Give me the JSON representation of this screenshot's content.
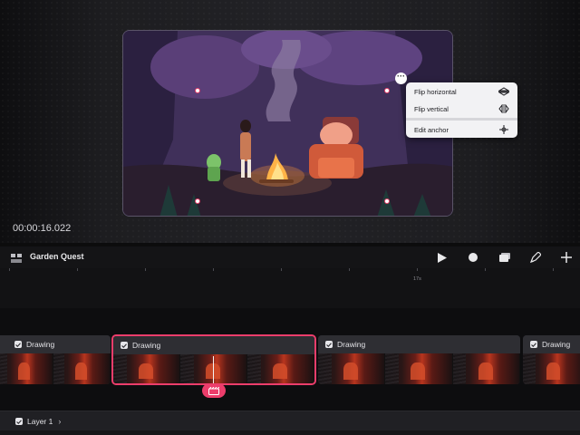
{
  "canvas": {
    "timecode": "00:00:16.022"
  },
  "context_menu": {
    "items": [
      {
        "label": "Flip horizontal",
        "icon": "flip-horizontal-icon"
      },
      {
        "label": "Flip vertical",
        "icon": "flip-vertical-icon"
      },
      {
        "label": "Edit anchor",
        "icon": "move-anchor-icon"
      }
    ]
  },
  "toolbar": {
    "project_title": "Garden Quest",
    "icons": [
      "layout-icon",
      "play-icon",
      "record-icon",
      "layers-icon",
      "draw-icon",
      "add-icon"
    ]
  },
  "ruler": {
    "label": "17s"
  },
  "tracks": {
    "clips": [
      {
        "label": "Drawing",
        "selected": false
      },
      {
        "label": "Drawing",
        "selected": true
      },
      {
        "label": "Drawing",
        "selected": false
      },
      {
        "label": "Drawing",
        "selected": false
      }
    ],
    "layer": {
      "label": "Layer 1"
    }
  },
  "colors": {
    "accent": "#ec3d6b",
    "background": "#0c0c0d",
    "menu": "#f2f2f4"
  }
}
